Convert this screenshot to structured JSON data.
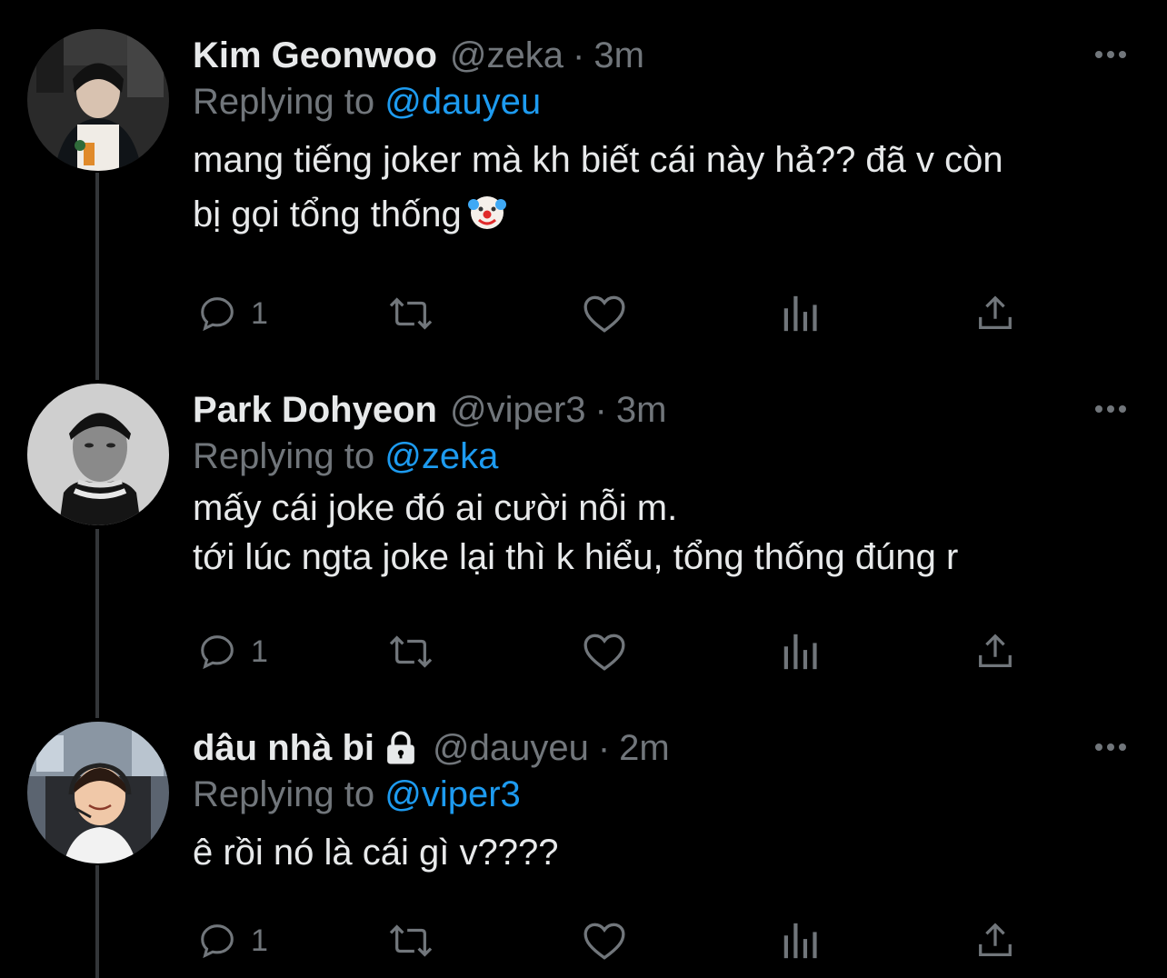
{
  "tweets": [
    {
      "name": "Kim Geonwoo",
      "handle": "@zeka",
      "dot": "·",
      "time": "3m",
      "replying_prefix": "Replying to",
      "replying_to": "@dauyeu",
      "text_lines": [
        "mang tiếng joker mà kh biết cái này hả?? đã v còn",
        "bị gọi tổng thống"
      ],
      "emoji": "clown-face-icon",
      "reply_count": "1",
      "locked": false
    },
    {
      "name": "Park Dohyeon",
      "handle": "@viper3",
      "dot": "·",
      "time": "3m",
      "replying_prefix": "Replying to",
      "replying_to": "@zeka",
      "text_lines": [
        "mấy cái joke đó ai cười nỗi m.",
        "tới lúc ngta joke lại thì k hiểu, tổng thống đúng r"
      ],
      "reply_count": "1",
      "locked": false
    },
    {
      "name": "dâu nhà bi",
      "handle": "@dauyeu",
      "dot": "·",
      "time": "2m",
      "replying_prefix": "Replying to",
      "replying_to": "@viper3",
      "text_lines": [
        "ê rồi nó là cái gì v????"
      ],
      "reply_count": "1",
      "locked": true
    }
  ],
  "colors": {
    "background": "#000000",
    "text": "#e7e9ea",
    "secondary": "#71767b",
    "link": "#1d9bf0",
    "thread_line": "#333639"
  },
  "icons": [
    "more-icon",
    "reply-icon",
    "retweet-icon",
    "like-icon",
    "analytics-icon",
    "share-icon",
    "lock-icon"
  ]
}
